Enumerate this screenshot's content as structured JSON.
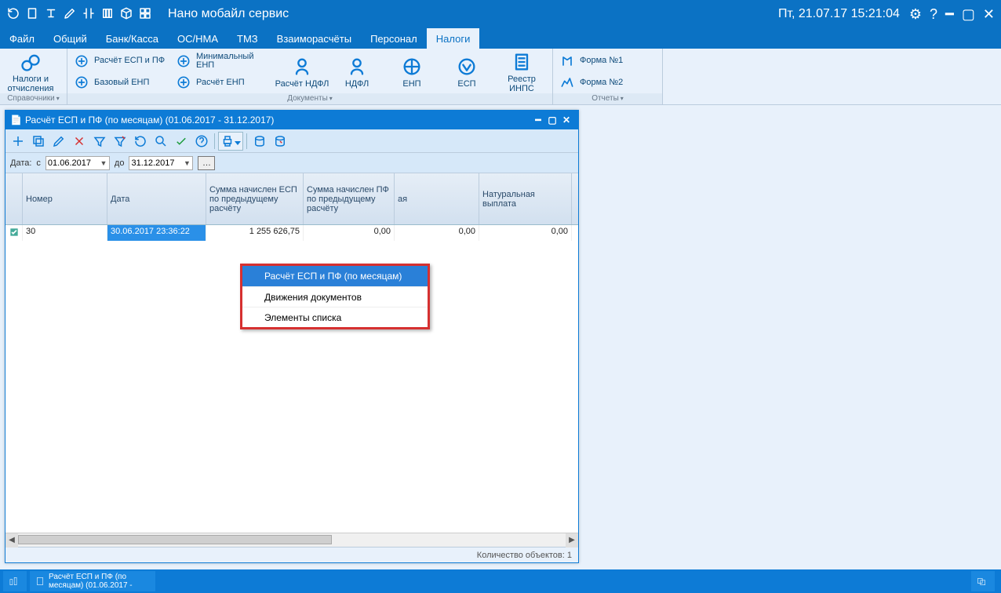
{
  "app_title": "Нано мобайл сервис",
  "datetime": "Пт, 21.07.17 15:21:04",
  "menu": [
    "Файл",
    "Общий",
    "Банк/Касса",
    "ОС/НМА",
    "ТМЗ",
    "Взаиморасчёты",
    "Персонал",
    "Налоги"
  ],
  "menu_active_index": 7,
  "ribbon": {
    "group1_label": "Справочники",
    "group1_btn": "Налоги и отчисления",
    "group2_label": "Документы",
    "group2_small": [
      "Расчёт ЕСП и ПФ",
      "Базовый ЕНП",
      "Минимальный ЕНП",
      "Расчёт ЕНП"
    ],
    "group2_big": [
      "Расчёт НДФЛ",
      "НДФЛ",
      "ЕНП",
      "ЕСП",
      "Реестр ИНПС"
    ],
    "group3_label": "Отчеты",
    "group3_small": [
      "Форма №1",
      "Форма №2"
    ]
  },
  "doc": {
    "title": "Расчёт ЕСП и ПФ (по месяцам) (01.06.2017 - 31.12.2017)",
    "filter": {
      "label_date": "Дата:",
      "label_from": "с",
      "label_to": "до",
      "from": "01.06.2017",
      "to": "31.12.2017"
    },
    "columns": [
      "",
      "Номер",
      "Дата",
      "Сумма начислен ЕСП по предыдущему расчёту",
      "Сумма начислен ПФ по предыдущему расчёту",
      "ая",
      "Натуральная выплата"
    ],
    "row": {
      "num": "30",
      "date": "30.06.2017 23:36:22",
      "c3": "1 255 626,75",
      "c4": "0,00",
      "c5": "0,00",
      "c6": "0,00"
    },
    "status": "Количество объектов: 1"
  },
  "context_menu": [
    "Расчёт ЕСП и ПФ (по месяцам)",
    "Движения документов",
    "Элементы списка"
  ],
  "taskbar_item": "Расчёт ЕСП и ПФ (по месяцам) (01.06.2017 -"
}
